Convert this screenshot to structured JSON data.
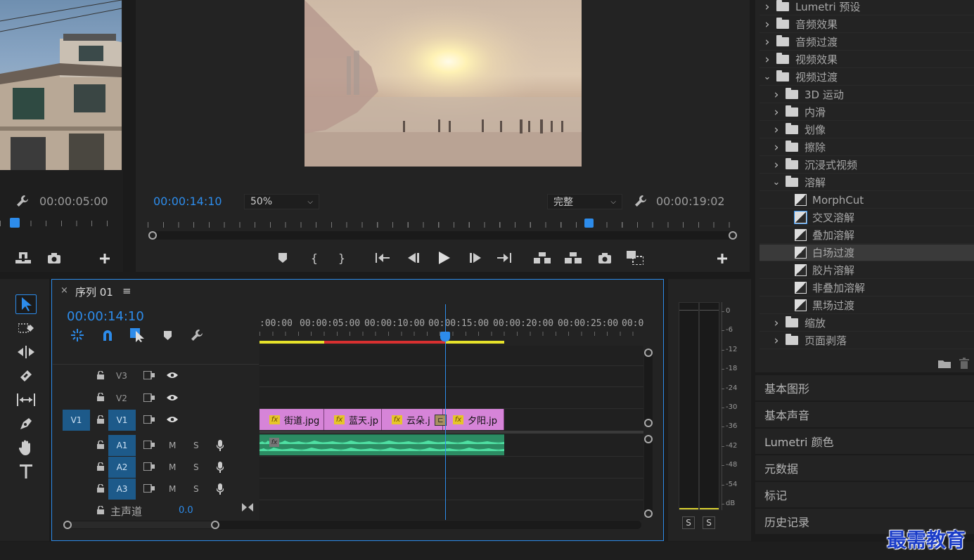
{
  "source_monitor": {
    "timecode": "00:00:05:00"
  },
  "program_monitor": {
    "current_time": "00:00:14:10",
    "zoom": "50%",
    "quality": "完整",
    "duration": "00:00:19:02"
  },
  "effects_tree": {
    "items": [
      {
        "label": "Lumetri 预设",
        "type": "folder",
        "expanded": false
      },
      {
        "label": "音频效果",
        "type": "folder",
        "expanded": false
      },
      {
        "label": "音频过渡",
        "type": "folder",
        "expanded": false
      },
      {
        "label": "视频效果",
        "type": "folder",
        "expanded": false
      },
      {
        "label": "视频过渡",
        "type": "folder",
        "expanded": true
      },
      {
        "label": "3D 运动",
        "type": "folder",
        "expanded": false
      },
      {
        "label": "内滑",
        "type": "folder",
        "expanded": false
      },
      {
        "label": "划像",
        "type": "folder",
        "expanded": false
      },
      {
        "label": "擦除",
        "type": "folder",
        "expanded": false
      },
      {
        "label": "沉浸式视频",
        "type": "folder",
        "expanded": false
      },
      {
        "label": "溶解",
        "type": "folder",
        "expanded": true
      },
      {
        "label": "MorphCut",
        "type": "transition"
      },
      {
        "label": "交叉溶解",
        "type": "transition",
        "state": "default"
      },
      {
        "label": "叠加溶解",
        "type": "transition"
      },
      {
        "label": "白场过渡",
        "type": "transition",
        "state": "selected"
      },
      {
        "label": "胶片溶解",
        "type": "transition"
      },
      {
        "label": "非叠加溶解",
        "type": "transition"
      },
      {
        "label": "黑场过渡",
        "type": "transition"
      },
      {
        "label": "缩放",
        "type": "folder",
        "expanded": false
      },
      {
        "label": "页面剥落",
        "type": "folder",
        "expanded": false
      }
    ]
  },
  "side_panels": [
    "基本图形",
    "基本声音",
    "Lumetri 颜色",
    "元数据",
    "标记",
    "历史记录"
  ],
  "sequence": {
    "tab_close": "×",
    "title": "序列 01",
    "menu": "≡",
    "current_time": "00:00:14:10",
    "ruler_labels": [
      ":00:00",
      "00:00:05:00",
      "00:00:10:00",
      "00:00:15:00",
      "00:00:20:00",
      "00:00:25:00",
      "00:00:"
    ],
    "playhead_time_seconds": 14.4,
    "video_tracks": [
      {
        "name": "V3",
        "source": ""
      },
      {
        "name": "V2",
        "source": ""
      },
      {
        "name": "V1",
        "source": "V1"
      }
    ],
    "audio_tracks": [
      {
        "name": "A1",
        "m": "M",
        "s": "S"
      },
      {
        "name": "A2",
        "m": "M",
        "s": "S"
      },
      {
        "name": "A3",
        "m": "M",
        "s": "S"
      }
    ],
    "master": {
      "label": "主声道",
      "value": "0.0"
    },
    "clips": [
      {
        "fx": "fx",
        "name": "街道.jpg"
      },
      {
        "fx": "fx",
        "name": "蓝天.jp"
      },
      {
        "fx": "fx",
        "name": "云朵.j"
      },
      {
        "fx": "fx",
        "name": "夕阳.jp"
      }
    ],
    "transition_marker": "白场过渡"
  },
  "audio_meter": {
    "scale": [
      "0",
      "-6",
      "-12",
      "-18",
      "-24",
      "-30",
      "-36",
      "-42",
      "-48",
      "-54",
      "dB"
    ],
    "solo_buttons": [
      "S",
      "S"
    ]
  },
  "watermark": "最需教育",
  "colors": {
    "accent_blue": "#2d8ceb",
    "clip_pink": "#d684d8",
    "audio_green": "#2fb37a",
    "work_area_yellow": "#e6e22a",
    "render_red": "#d83030"
  }
}
